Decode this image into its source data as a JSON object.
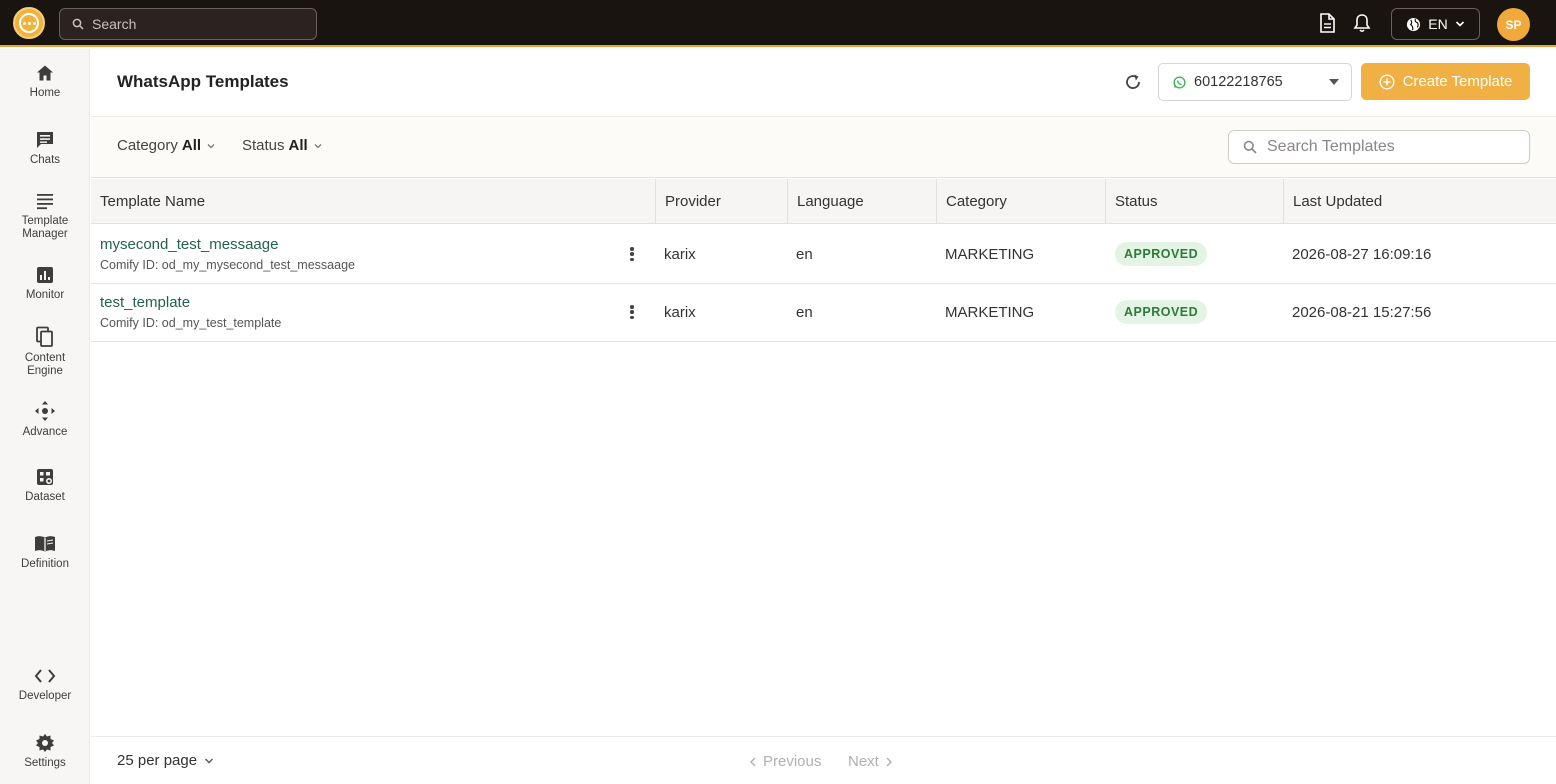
{
  "topbar": {
    "search_placeholder": "Search",
    "lang": "EN",
    "avatar_initials": "SP"
  },
  "sidebar": {
    "items": [
      {
        "label": "Home",
        "icon": "home-icon"
      },
      {
        "label": "Chats",
        "icon": "chat-icon"
      },
      {
        "label": "Template Manager",
        "icon": "template-icon"
      },
      {
        "label": "Monitor",
        "icon": "monitor-icon"
      },
      {
        "label": "Content Engine",
        "icon": "content-icon"
      },
      {
        "label": "Advance",
        "icon": "advance-icon"
      },
      {
        "label": "Dataset",
        "icon": "dataset-icon"
      },
      {
        "label": "Definition",
        "icon": "definition-icon"
      },
      {
        "label": "Developer",
        "icon": "code-icon"
      },
      {
        "label": "Settings",
        "icon": "gear-icon"
      }
    ]
  },
  "header": {
    "title": "WhatsApp Templates",
    "phone": "60122218765",
    "create_label": "Create Template"
  },
  "filters": {
    "category_label": "Category",
    "category_value": "All",
    "status_label": "Status",
    "status_value": "All",
    "search_placeholder": "Search Templates"
  },
  "table": {
    "columns": [
      "Template Name",
      "Provider",
      "Language",
      "Category",
      "Status",
      "Last Updated"
    ],
    "rows": [
      {
        "name": "mysecond_test_messaage",
        "comify_id": "Comify ID: od_my_mysecond_test_messaage",
        "provider": "karix",
        "language": "en",
        "category": "MARKETING",
        "status": "APPROVED",
        "updated": "2026-08-27 16:09:16"
      },
      {
        "name": "test_template",
        "comify_id": "Comify ID: od_my_test_template",
        "provider": "karix",
        "language": "en",
        "category": "MARKETING",
        "status": "APPROVED",
        "updated": "2026-08-21 15:27:56"
      }
    ]
  },
  "footer": {
    "per_page": "25 per page",
    "previous": "Previous",
    "next": "Next"
  },
  "colors": {
    "topbar_bg": "#1a1410",
    "accent": "#f1b043",
    "link": "#23624f",
    "approved_bg": "#e3f3e4",
    "approved_text": "#2f7a3a"
  }
}
